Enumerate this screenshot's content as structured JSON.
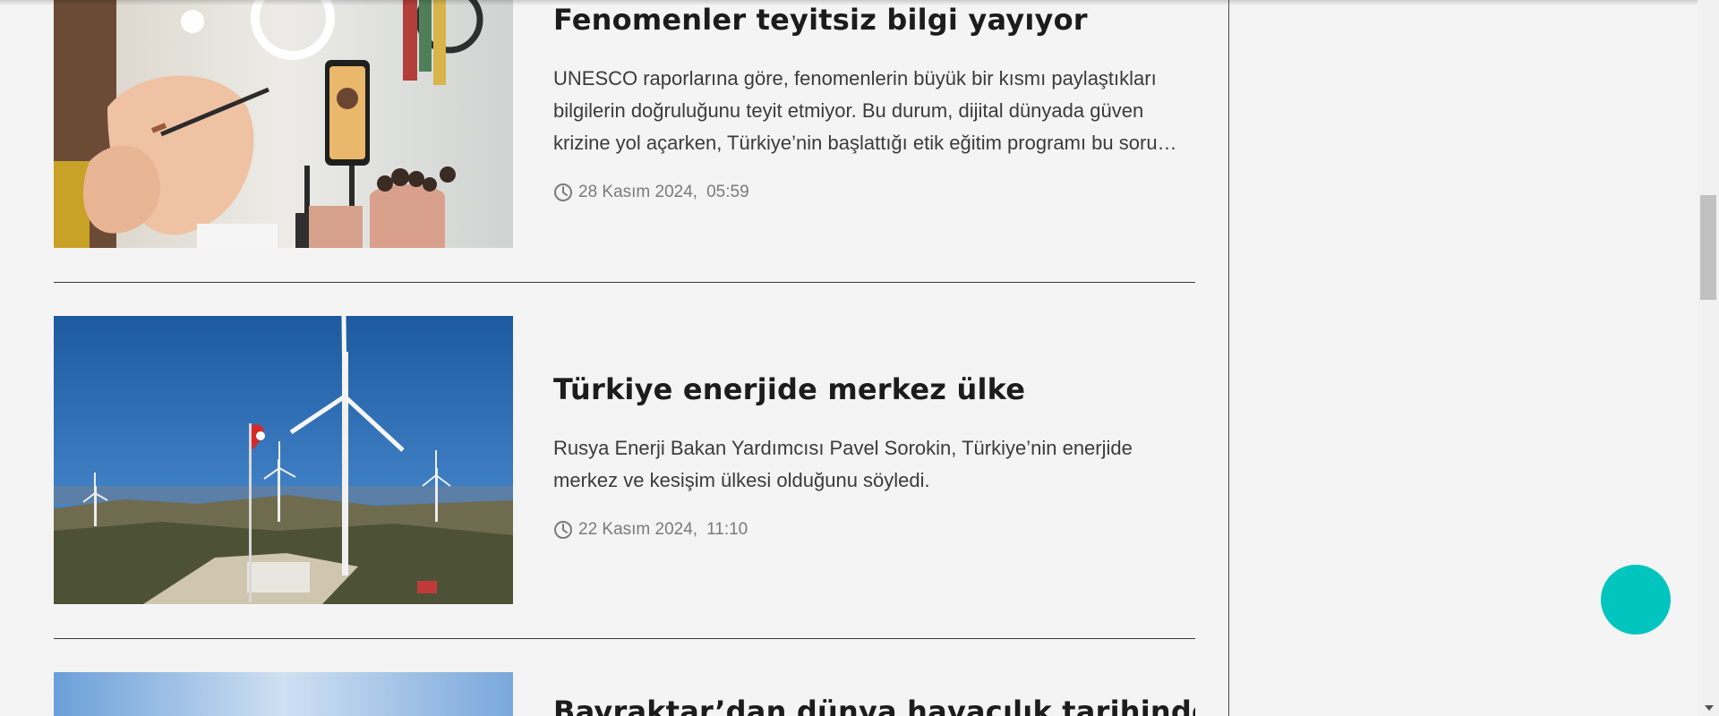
{
  "articles": [
    {
      "title": "Fenomenler teyitsiz bilgi yayıyor",
      "summary": "UNESCO raporlarına göre, fenomenlerin büyük bir kısmı paylaştıkları bilgilerin doğruluğunu teyit etmiyor. Bu durum, dijital dünyada güven krizine yol açarken, Türkiye’nin başlattığı etik eğitim programı bu soru…",
      "date": "28 Kasım 2024,",
      "time": "05:59",
      "image": "makeup-influencer-photo"
    },
    {
      "title": "Türkiye enerjide merkez ülke",
      "summary": "Rusya Enerji Bakan Yardımcısı Pavel Sorokin, Türkiye’nin enerjide merkez ve kesişim ülkesi olduğunu söyledi.",
      "date": "22 Kasım 2024,",
      "time": "11:10",
      "image": "wind-turbines-photo"
    },
    {
      "title": "Bayraktar’dan dünya havacılık tarihinde",
      "image": "sky-photo"
    }
  ],
  "colors": {
    "background": "#f4f4f4",
    "title": "#1c1c1c",
    "meta": "#7a7a7a",
    "fab": "#00c5be"
  },
  "icons": {
    "clock": "clock-icon"
  }
}
